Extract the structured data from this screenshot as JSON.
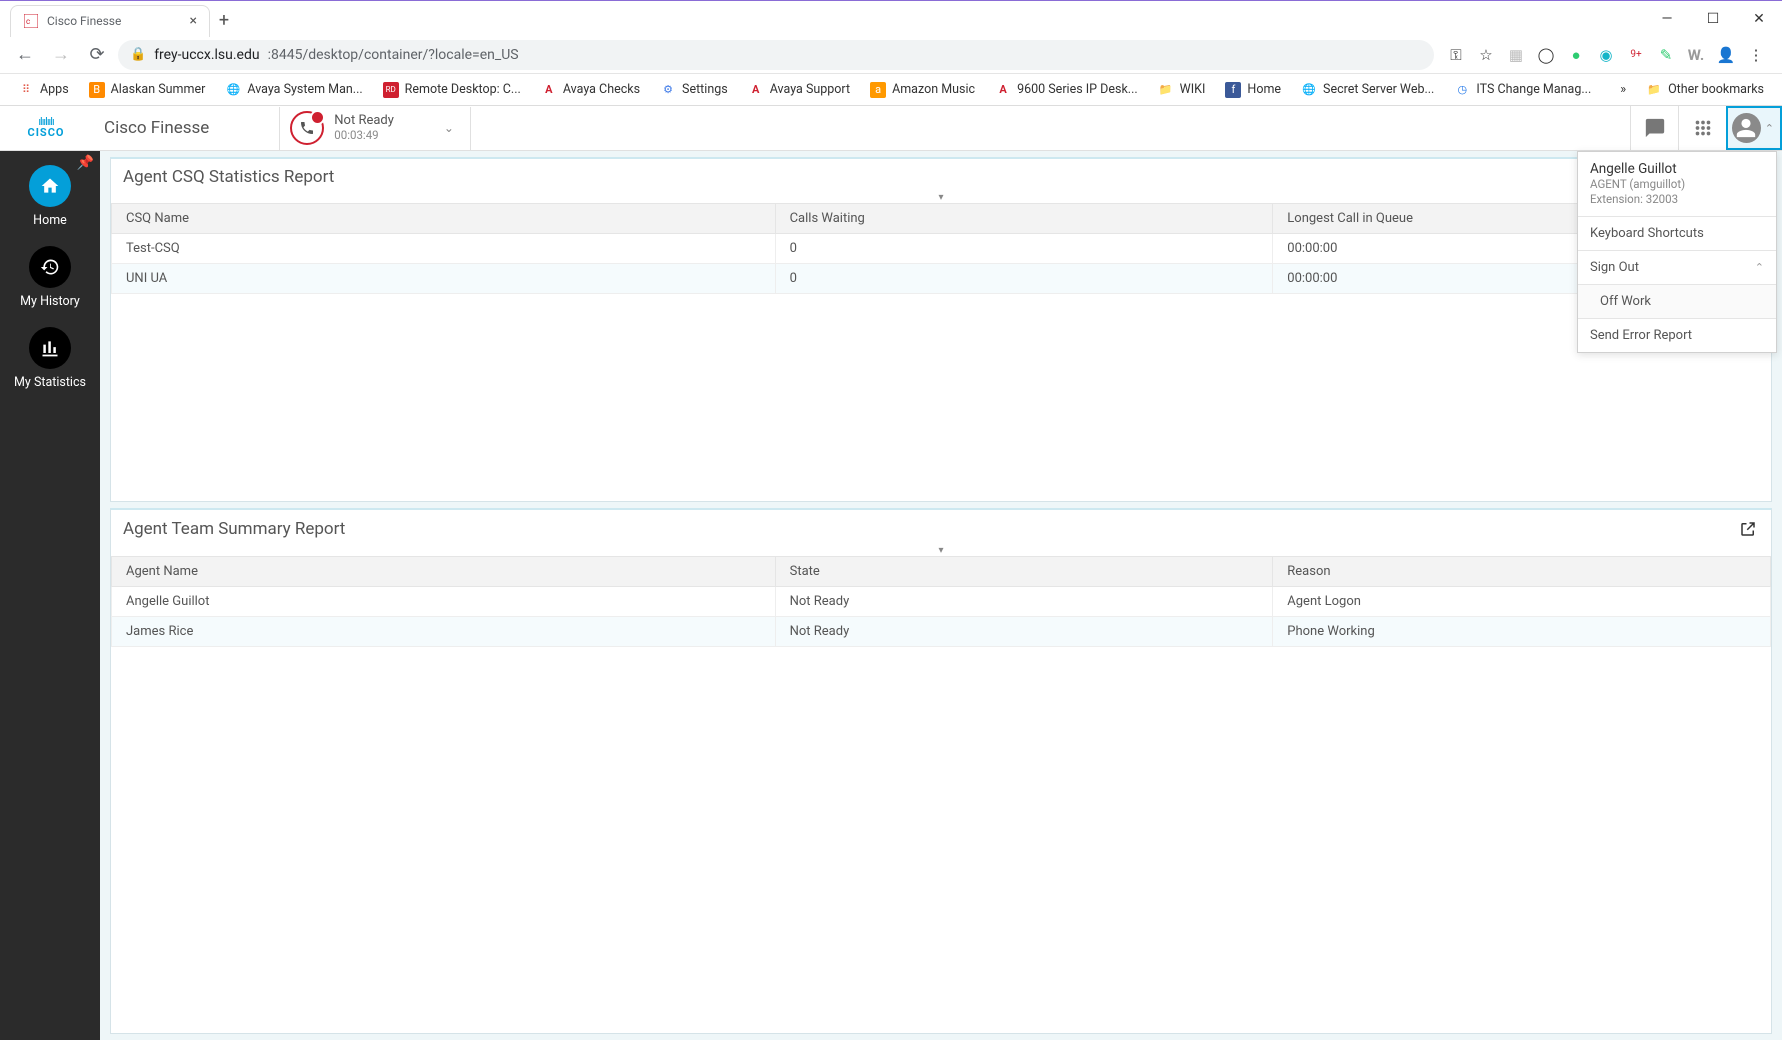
{
  "browser": {
    "tab_title": "Cisco Finesse",
    "url_host": "frey-uccx.lsu.edu",
    "url_port_path": ":8445/desktop/container/?locale=en_US",
    "apps_label": "Apps",
    "bookmarks": [
      "Alaskan Summer",
      "Avaya System Man...",
      "Remote Desktop: C...",
      "Avaya Checks",
      "Settings",
      "Avaya Support",
      "Amazon Music",
      "9600 Series IP Desk...",
      "WIKI",
      "Home",
      "Secret Server Web...",
      "ITS Change Manag..."
    ],
    "other_bookmarks": "Other bookmarks"
  },
  "header": {
    "app_title": "Cisco Finesse",
    "state_label": "Not Ready",
    "state_timer": "00:03:49"
  },
  "sidebar": {
    "items": [
      "Home",
      "My History",
      "My Statistics"
    ]
  },
  "dropdown": {
    "name": "Angelle Guillot",
    "role": "AGENT (amguillot)",
    "extension": "Extension: 32003",
    "shortcuts": "Keyboard Shortcuts",
    "signout": "Sign Out",
    "offwork": "Off Work",
    "send_error": "Send Error Report"
  },
  "panel1": {
    "title": "Agent CSQ Statistics Report",
    "cols": [
      "CSQ Name",
      "Calls Waiting",
      "Longest Call in Queue"
    ],
    "rows": [
      {
        "c0": "Test-CSQ",
        "c1": "0",
        "c2": "00:00:00"
      },
      {
        "c0": "UNI UA",
        "c1": "0",
        "c2": "00:00:00"
      }
    ]
  },
  "panel2": {
    "title": "Agent Team Summary Report",
    "cols": [
      "Agent Name",
      "State",
      "Reason"
    ],
    "rows": [
      {
        "c0": "Angelle Guillot",
        "c1": "Not Ready",
        "c2": "Agent Logon"
      },
      {
        "c0": "James Rice",
        "c1": "Not Ready",
        "c2": "Phone Working"
      }
    ]
  }
}
